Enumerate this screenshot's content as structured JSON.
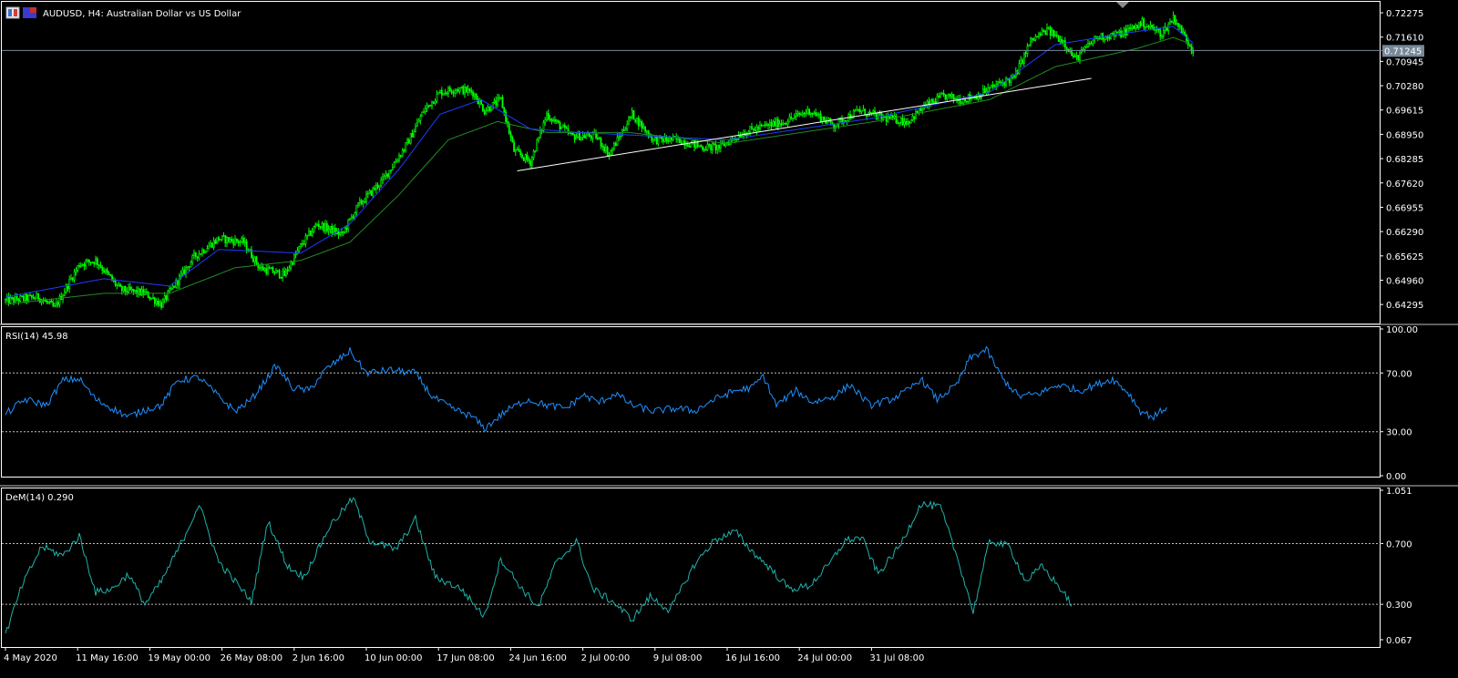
{
  "window": {
    "title": "AUDUSD, H4:  Australian Dollar vs US Dollar"
  },
  "colors": {
    "background": "#000000",
    "frame": "#ffffff",
    "candle_up": "#00ff00",
    "candle_down": "#00ff00",
    "ma_fast": "#1e3cff",
    "ma_slow": "#228b22",
    "trendline": "#ffffff",
    "rsi_line": "#1e90ff",
    "dem_line": "#20b2aa",
    "level_line": "#c0c0c0",
    "bid_line": "#778899",
    "bid_label_bg": "#778899",
    "text": "#ffffff"
  },
  "chart_data": [
    {
      "type": "candlestick",
      "title": "AUDUSD, H4:  Australian Dollar vs US Dollar",
      "ylim": [
        0.6385,
        0.725
      ],
      "y_ticks": [
        "0.72275",
        "0.71610",
        "0.70945",
        "0.70280",
        "0.69615",
        "0.68950",
        "0.68285",
        "0.67620",
        "0.66955",
        "0.66290",
        "0.65625",
        "0.64960",
        "0.64295"
      ],
      "current_price": "0.71245",
      "x_ticks": [
        "4 May 2020",
        "11 May 16:00",
        "19 May 00:00",
        "26 May 08:00",
        "2 Jun 16:00",
        "10 Jun 00:00",
        "17 Jun 08:00",
        "24 Jun 16:00",
        "2 Jul 00:00",
        "9 Jul 08:00",
        "16 Jul 16:00",
        "24 Jul 00:00",
        "31 Jul 08:00"
      ],
      "bars_per_label": 44,
      "close_path": [
        [
          0,
          0.644
        ],
        [
          20,
          0.645
        ],
        [
          30,
          0.642
        ],
        [
          45,
          0.654
        ],
        [
          55,
          0.655
        ],
        [
          70,
          0.647
        ],
        [
          85,
          0.646
        ],
        [
          95,
          0.643
        ],
        [
          115,
          0.656
        ],
        [
          130,
          0.661
        ],
        [
          145,
          0.66
        ],
        [
          155,
          0.653
        ],
        [
          170,
          0.651
        ],
        [
          180,
          0.659
        ],
        [
          190,
          0.665
        ],
        [
          205,
          0.662
        ],
        [
          215,
          0.67
        ],
        [
          230,
          0.677
        ],
        [
          245,
          0.687
        ],
        [
          255,
          0.696
        ],
        [
          265,
          0.701
        ],
        [
          275,
          0.702
        ],
        [
          285,
          0.701
        ],
        [
          292,
          0.696
        ],
        [
          302,
          0.699
        ],
        [
          310,
          0.685
        ],
        [
          320,
          0.682
        ],
        [
          330,
          0.695
        ],
        [
          345,
          0.689
        ],
        [
          360,
          0.689
        ],
        [
          368,
          0.684
        ],
        [
          382,
          0.695
        ],
        [
          395,
          0.688
        ],
        [
          410,
          0.688
        ],
        [
          425,
          0.686
        ],
        [
          435,
          0.686
        ],
        [
          450,
          0.69
        ],
        [
          465,
          0.692
        ],
        [
          475,
          0.693
        ],
        [
          490,
          0.696
        ],
        [
          505,
          0.692
        ],
        [
          520,
          0.696
        ],
        [
          535,
          0.694
        ],
        [
          550,
          0.693
        ],
        [
          560,
          0.697
        ],
        [
          572,
          0.7
        ],
        [
          582,
          0.699
        ],
        [
          592,
          0.7
        ],
        [
          604,
          0.703
        ],
        [
          615,
          0.705
        ],
        [
          625,
          0.715
        ],
        [
          635,
          0.718
        ],
        [
          645,
          0.715
        ],
        [
          652,
          0.71
        ],
        [
          665,
          0.716
        ],
        [
          680,
          0.717
        ],
        [
          693,
          0.72
        ],
        [
          705,
          0.717
        ],
        [
          712,
          0.7215
        ],
        [
          718,
          0.717
        ],
        [
          724,
          0.7125
        ]
      ],
      "ma_fast": [
        [
          0,
          0.645
        ],
        [
          60,
          0.65
        ],
        [
          100,
          0.648
        ],
        [
          130,
          0.658
        ],
        [
          180,
          0.657
        ],
        [
          210,
          0.665
        ],
        [
          240,
          0.68
        ],
        [
          265,
          0.695
        ],
        [
          290,
          0.699
        ],
        [
          320,
          0.691
        ],
        [
          350,
          0.69
        ],
        [
          440,
          0.688
        ],
        [
          530,
          0.694
        ],
        [
          600,
          0.701
        ],
        [
          640,
          0.714
        ],
        [
          680,
          0.717
        ],
        [
          712,
          0.719
        ],
        [
          724,
          0.7145
        ]
      ],
      "ma_slow": [
        [
          0,
          0.643
        ],
        [
          60,
          0.646
        ],
        [
          100,
          0.646
        ],
        [
          140,
          0.653
        ],
        [
          180,
          0.655
        ],
        [
          210,
          0.66
        ],
        [
          240,
          0.673
        ],
        [
          270,
          0.688
        ],
        [
          300,
          0.693
        ],
        [
          330,
          0.69
        ],
        [
          380,
          0.69
        ],
        [
          440,
          0.687
        ],
        [
          530,
          0.693
        ],
        [
          600,
          0.699
        ],
        [
          640,
          0.708
        ],
        [
          690,
          0.713
        ],
        [
          712,
          0.716
        ],
        [
          724,
          0.714
        ]
      ],
      "trendline": [
        [
          312,
          0.6795
        ],
        [
          662,
          0.7048
        ]
      ]
    },
    {
      "type": "line",
      "title": "RSI(14) 45.98",
      "name": "RSI(14)",
      "value": "45.98",
      "ylim": [
        0,
        100
      ],
      "y_ticks": [
        "100.00",
        "70.00",
        "30.00",
        "0.00"
      ],
      "levels": [
        70,
        30
      ],
      "path": [
        [
          0,
          42
        ],
        [
          12,
          52
        ],
        [
          25,
          48
        ],
        [
          35,
          65
        ],
        [
          45,
          66
        ],
        [
          55,
          52
        ],
        [
          65,
          46
        ],
        [
          75,
          40
        ],
        [
          85,
          45
        ],
        [
          95,
          48
        ],
        [
          105,
          65
        ],
        [
          118,
          67
        ],
        [
          130,
          54
        ],
        [
          140,
          44
        ],
        [
          150,
          52
        ],
        [
          165,
          75
        ],
        [
          175,
          60
        ],
        [
          185,
          58
        ],
        [
          195,
          72
        ],
        [
          210,
          85
        ],
        [
          220,
          70
        ],
        [
          235,
          72
        ],
        [
          250,
          70
        ],
        [
          260,
          54
        ],
        [
          272,
          46
        ],
        [
          285,
          40
        ],
        [
          292,
          32
        ],
        [
          305,
          44
        ],
        [
          318,
          52
        ],
        [
          330,
          48
        ],
        [
          342,
          46
        ],
        [
          352,
          55
        ],
        [
          362,
          50
        ],
        [
          372,
          56
        ],
        [
          382,
          48
        ],
        [
          395,
          44
        ],
        [
          410,
          46
        ],
        [
          420,
          44
        ],
        [
          432,
          52
        ],
        [
          445,
          58
        ],
        [
          455,
          60
        ],
        [
          462,
          68
        ],
        [
          470,
          48
        ],
        [
          482,
          58
        ],
        [
          492,
          50
        ],
        [
          505,
          54
        ],
        [
          515,
          62
        ],
        [
          527,
          48
        ],
        [
          540,
          52
        ],
        [
          550,
          58
        ],
        [
          558,
          66
        ],
        [
          568,
          52
        ],
        [
          580,
          62
        ],
        [
          588,
          80
        ],
        [
          598,
          86
        ],
        [
          608,
          66
        ],
        [
          618,
          54
        ],
        [
          630,
          56
        ],
        [
          642,
          62
        ],
        [
          655,
          58
        ],
        [
          665,
          62
        ],
        [
          675,
          66
        ],
        [
          685,
          56
        ],
        [
          692,
          44
        ],
        [
          700,
          40
        ],
        [
          708,
          47
        ]
      ]
    },
    {
      "type": "line",
      "title": "DeM(14) 0.290",
      "name": "DeM(14)",
      "value": "0.290",
      "ylim": [
        0.067,
        1.051
      ],
      "y_ticks": [
        "1.051",
        "0.700",
        "0.300",
        "0.067"
      ],
      "levels": [
        0.7,
        0.3
      ],
      "path": [
        [
          0,
          0.1
        ],
        [
          10,
          0.42
        ],
        [
          22,
          0.68
        ],
        [
          35,
          0.62
        ],
        [
          45,
          0.75
        ],
        [
          55,
          0.38
        ],
        [
          65,
          0.4
        ],
        [
          75,
          0.5
        ],
        [
          85,
          0.3
        ],
        [
          95,
          0.45
        ],
        [
          108,
          0.72
        ],
        [
          118,
          0.96
        ],
        [
          130,
          0.58
        ],
        [
          140,
          0.45
        ],
        [
          150,
          0.32
        ],
        [
          160,
          0.85
        ],
        [
          172,
          0.55
        ],
        [
          182,
          0.48
        ],
        [
          198,
          0.82
        ],
        [
          212,
          1.0
        ],
        [
          222,
          0.72
        ],
        [
          238,
          0.66
        ],
        [
          250,
          0.86
        ],
        [
          262,
          0.48
        ],
        [
          278,
          0.4
        ],
        [
          292,
          0.22
        ],
        [
          302,
          0.6
        ],
        [
          315,
          0.4
        ],
        [
          325,
          0.28
        ],
        [
          335,
          0.56
        ],
        [
          348,
          0.72
        ],
        [
          358,
          0.4
        ],
        [
          370,
          0.32
        ],
        [
          382,
          0.2
        ],
        [
          393,
          0.35
        ],
        [
          405,
          0.26
        ],
        [
          420,
          0.56
        ],
        [
          432,
          0.72
        ],
        [
          445,
          0.78
        ],
        [
          455,
          0.65
        ],
        [
          465,
          0.55
        ],
        [
          478,
          0.4
        ],
        [
          490,
          0.42
        ],
        [
          502,
          0.56
        ],
        [
          512,
          0.72
        ],
        [
          522,
          0.74
        ],
        [
          532,
          0.5
        ],
        [
          545,
          0.68
        ],
        [
          558,
          0.96
        ],
        [
          570,
          0.94
        ],
        [
          582,
          0.55
        ],
        [
          590,
          0.25
        ],
        [
          600,
          0.72
        ],
        [
          612,
          0.68
        ],
        [
          622,
          0.45
        ],
        [
          632,
          0.55
        ],
        [
          642,
          0.42
        ],
        [
          650,
          0.3
        ]
      ]
    }
  ]
}
